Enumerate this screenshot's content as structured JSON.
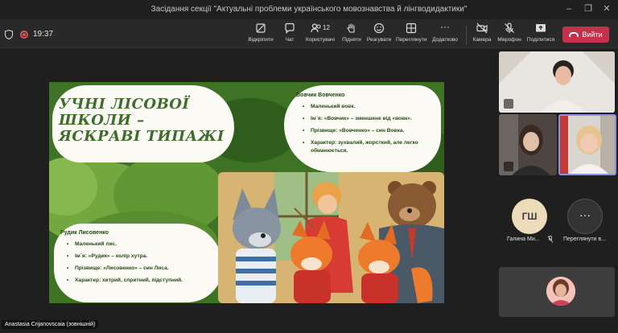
{
  "window": {
    "title": "Засідання секції \"Актуальні проблеми українського мовознавства й лінгводидактики\""
  },
  "toolbar": {
    "timer": "19:37",
    "items": [
      {
        "label": "Відкріпити",
        "icon": "unpin-icon"
      },
      {
        "label": "Чат",
        "icon": "chat-icon"
      },
      {
        "label": "Користувачі",
        "icon": "people-icon",
        "count": "12"
      },
      {
        "label": "Підняти",
        "icon": "raise-hand-icon"
      },
      {
        "label": "Реагувати",
        "icon": "react-icon"
      },
      {
        "label": "Переглянути",
        "icon": "view-icon"
      },
      {
        "label": "Додатково",
        "icon": "more-icon",
        "glyph": "···"
      },
      {
        "label": "Камера",
        "icon": "camera-off-icon"
      },
      {
        "label": "Мікрофон",
        "icon": "mic-off-icon"
      },
      {
        "label": "Поділитися",
        "icon": "share-icon"
      }
    ],
    "leave_label": "Вийти",
    "leave_color": "#c4314b"
  },
  "slide": {
    "title": "УЧНІ ЛІСОВОЇ ШКОЛИ – ЯСКРАВІ ТИПАЖІ",
    "wolf": {
      "heading": "Вовчик Вовченко",
      "points": [
        "Маленький вовк.",
        "Ім`я: «Вовчик» – зменшене від «вовк».",
        "Прізвище: «Вовченко» – син Вовка.",
        "Характер: зухвалий, жорсткий, але легко",
        "обманюється."
      ]
    },
    "fox": {
      "heading": "Рудик Лисовенко",
      "points": [
        "Маленький лис.",
        "Ім`я: «Рудик» – колір хутра.",
        "Прізвище: «Лисовенко» – син Лиса.",
        "Характер: хитрий, спритний, підступний."
      ]
    },
    "background_color": "#3b6d24"
  },
  "participants": {
    "initials": "ГШ",
    "initials_name": "Галина Ми...",
    "more_label": "Переглянути в...",
    "more_glyph": "···"
  },
  "presenter_name": "Anastasia Crijanovscaia (зовнішній)"
}
